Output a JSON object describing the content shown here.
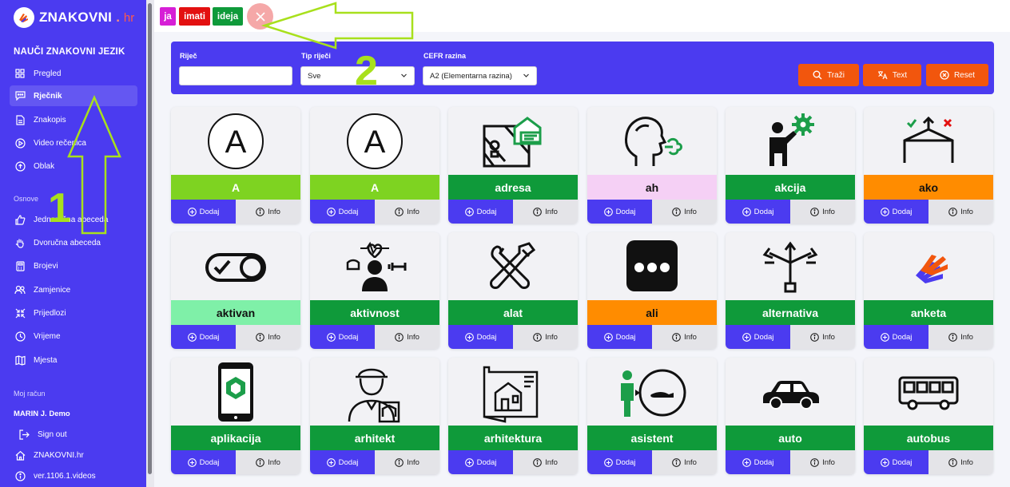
{
  "app": {
    "logo_text": "ZNAKOVNI",
    "logo_sep": ".",
    "logo_domain": "hr"
  },
  "sidebar": {
    "heading": "NAUČI ZNAKOVNI JEZIK",
    "items": [
      {
        "label": "Pregled",
        "icon": "grid-icon"
      },
      {
        "label": "Rječnik",
        "icon": "chat-icon",
        "active": true
      },
      {
        "label": "Znakopis",
        "icon": "document-icon"
      },
      {
        "label": "Video rečenica",
        "icon": "play-icon"
      },
      {
        "label": "Oblak",
        "icon": "cloud-upload-icon"
      }
    ],
    "section_osnove": "Osnove",
    "basics": [
      {
        "label": "Jednoručna abeceda",
        "icon": "thumb-icon"
      },
      {
        "label": "Dvoručna abeceda",
        "icon": "hand-icon"
      },
      {
        "label": "Brojevi",
        "icon": "calculator-icon"
      },
      {
        "label": "Zamjenice",
        "icon": "users-icon"
      },
      {
        "label": "Prijedlozi",
        "icon": "arrows-icon"
      },
      {
        "label": "Vrijeme",
        "icon": "clock-icon"
      },
      {
        "label": "Mjesta",
        "icon": "map-icon"
      }
    ],
    "section_account": "Moj račun",
    "user_name": "MARIN J. Demo",
    "account": [
      {
        "label": "Sign out",
        "icon": "sign-out-icon"
      },
      {
        "label": "ZNAKOVNI.hr",
        "icon": "home-icon"
      },
      {
        "label": "ver.1106.1.videos",
        "icon": "info-icon"
      }
    ]
  },
  "topbar": {
    "chips": [
      {
        "label": "ja",
        "color": "#d61fd6"
      },
      {
        "label": "imati",
        "color": "#e31010"
      },
      {
        "label": "ideja",
        "color": "#0f9a3a"
      }
    ]
  },
  "filter": {
    "word_label": "Riječ",
    "word_value": "",
    "type_label": "Tip riječi",
    "type_value": "Sve",
    "cefr_label": "CEFR razina",
    "cefr_value": "A2 (Elementarna razina)",
    "search_label": "Traži",
    "text_label": "Text",
    "reset_label": "Reset"
  },
  "cards": {
    "add_label": "Dodaj",
    "info_label": "Info",
    "items": [
      {
        "label": "A",
        "color": "#7ed321",
        "icon": "letter-a-icon"
      },
      {
        "label": "A",
        "color": "#7ed321",
        "icon": "letter-a-icon"
      },
      {
        "label": "adresa",
        "color": "#0f9a3a",
        "icon": "address-map-icon"
      },
      {
        "label": "ah",
        "color": "#f5d0f5",
        "icon": "head-breath-icon"
      },
      {
        "label": "akcija",
        "color": "#0f9a3a",
        "icon": "person-gear-icon"
      },
      {
        "label": "ako",
        "color": "#ff8c00",
        "icon": "decision-icon"
      },
      {
        "label": "aktivan",
        "color": "#7ff0a8",
        "icon": "toggle-icon"
      },
      {
        "label": "aktivnost",
        "color": "#0f9a3a",
        "icon": "activity-person-icon"
      },
      {
        "label": "alat",
        "color": "#0f9a3a",
        "icon": "tools-icon"
      },
      {
        "label": "ali",
        "color": "#ff8c00",
        "icon": "dots-icon"
      },
      {
        "label": "alternativa",
        "color": "#0f9a3a",
        "icon": "split-arrows-icon"
      },
      {
        "label": "anketa",
        "color": "#0f9a3a",
        "icon": "sign-hands-icon"
      },
      {
        "label": "aplikacija",
        "color": "#0f9a3a",
        "icon": "phone-app-icon"
      },
      {
        "label": "arhitekt",
        "color": "#0f9a3a",
        "icon": "architect-icon"
      },
      {
        "label": "arhitektura",
        "color": "#0f9a3a",
        "icon": "blueprint-icon"
      },
      {
        "label": "asistent",
        "color": "#0f9a3a",
        "icon": "assistant-icon"
      },
      {
        "label": "auto",
        "color": "#0f9a3a",
        "icon": "car-icon"
      },
      {
        "label": "autobus",
        "color": "#0f9a3a",
        "icon": "bus-icon"
      }
    ]
  },
  "annotations": {
    "one": "1",
    "two": "2",
    "color": "#a8e01c"
  },
  "colors": {
    "primary": "#4b3bf0",
    "accent": "#f2560d"
  }
}
